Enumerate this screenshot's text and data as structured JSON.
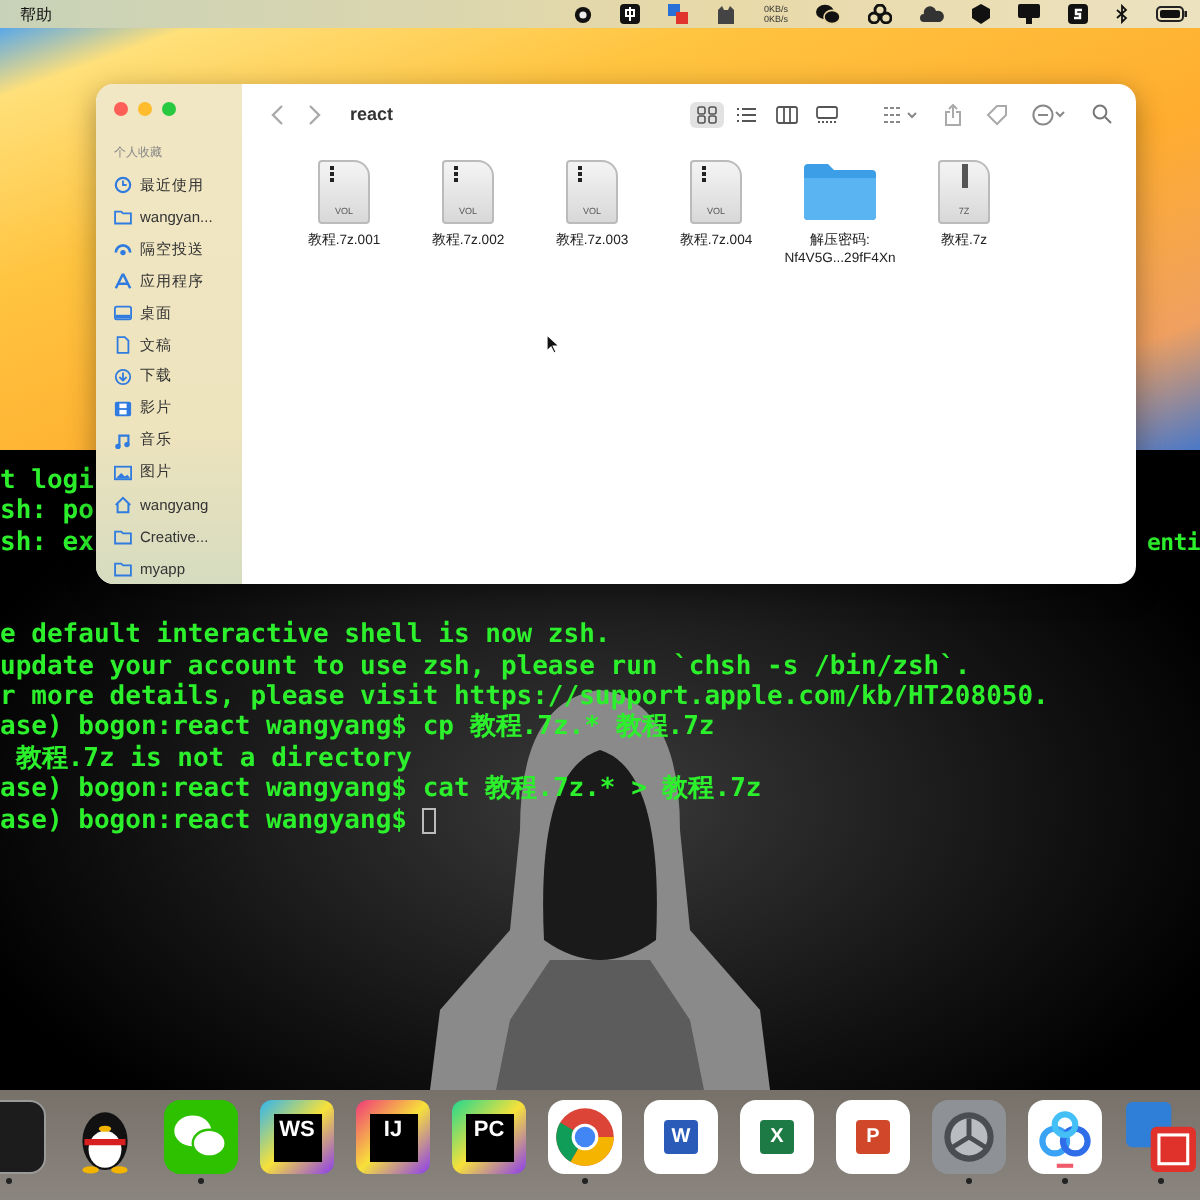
{
  "menu_bar": {
    "menu": "帮助",
    "network_speed": [
      "0KB/s",
      "0KB/s"
    ]
  },
  "finder": {
    "folder_title": "react",
    "sidebar": {
      "heading": "个人收藏",
      "items": [
        {
          "kind": "clock",
          "label": "最近使用"
        },
        {
          "kind": "folder",
          "label": "wangyan..."
        },
        {
          "kind": "airdrop",
          "label": "隔空投送"
        },
        {
          "kind": "apps",
          "label": "应用程序"
        },
        {
          "kind": "desktop",
          "label": "桌面"
        },
        {
          "kind": "doc",
          "label": "文稿"
        },
        {
          "kind": "download",
          "label": "下载"
        },
        {
          "kind": "film",
          "label": "影片"
        },
        {
          "kind": "music",
          "label": "音乐"
        },
        {
          "kind": "picture",
          "label": "图片"
        },
        {
          "kind": "home",
          "label": "wangyang"
        },
        {
          "kind": "folder",
          "label": "Creative..."
        },
        {
          "kind": "folder",
          "label": "myapp"
        }
      ]
    },
    "view_buttons": [
      {
        "kind": "grid",
        "selected": true
      },
      {
        "kind": "list",
        "selected": false
      },
      {
        "kind": "columns",
        "selected": false
      },
      {
        "kind": "gallery",
        "selected": false
      }
    ],
    "files": [
      {
        "kind": "volume",
        "badge": "VOL",
        "name_lines": [
          "教程.7z.001"
        ]
      },
      {
        "kind": "volume",
        "badge": "VOL",
        "name_lines": [
          "教程.7z.002"
        ]
      },
      {
        "kind": "volume",
        "badge": "VOL",
        "name_lines": [
          "教程.7z.003"
        ]
      },
      {
        "kind": "volume",
        "badge": "VOL",
        "name_lines": [
          "教程.7z.004"
        ]
      },
      {
        "kind": "folder",
        "name_lines": [
          "解压密码:",
          "Nf4V5G...29fF4Xn"
        ]
      },
      {
        "kind": "archive",
        "badge": "7Z",
        "name_lines": [
          "教程.7z"
        ]
      }
    ]
  },
  "terminal": {
    "login_lines": [
      {
        "left": "t logi"
      },
      {
        "left": "sh: po"
      },
      {
        "left": "sh: ex",
        "right": "enti"
      }
    ],
    "session_lines": [
      "e default interactive shell is now zsh.",
      "update your account to use zsh, please run `chsh -s /bin/zsh`.",
      "r more details, please visit https://support.apple.com/kb/HT208050.",
      "ase) bogon:react wangyang$ cp 教程.7z.* 教程.7z",
      " 教程.7z is not a directory",
      "ase) bogon:react wangyang$ cat 教程.7z.* > 教程.7z"
    ],
    "prompt": "ase) bogon:react wangyang$ "
  },
  "dock": [
    {
      "kind": "terminal",
      "running": true
    },
    {
      "kind": "penguin",
      "running": false
    },
    {
      "kind": "chat",
      "running": true
    },
    {
      "kind": "jetbrains",
      "label": "WS",
      "running": false
    },
    {
      "kind": "jetbrains",
      "label": "IJ",
      "running": false
    },
    {
      "kind": "jetbrains",
      "label": "PC",
      "running": false
    },
    {
      "kind": "browser",
      "running": true
    },
    {
      "kind": "office",
      "label": "W",
      "color": "#2b5bb8",
      "running": false
    },
    {
      "kind": "office",
      "label": "X",
      "color": "#1d7a45",
      "running": false
    },
    {
      "kind": "office",
      "label": "P",
      "color": "#d0472a",
      "running": false
    },
    {
      "kind": "settings",
      "running": true
    },
    {
      "kind": "cloud",
      "running": true
    },
    {
      "kind": "vm",
      "running": true
    }
  ]
}
